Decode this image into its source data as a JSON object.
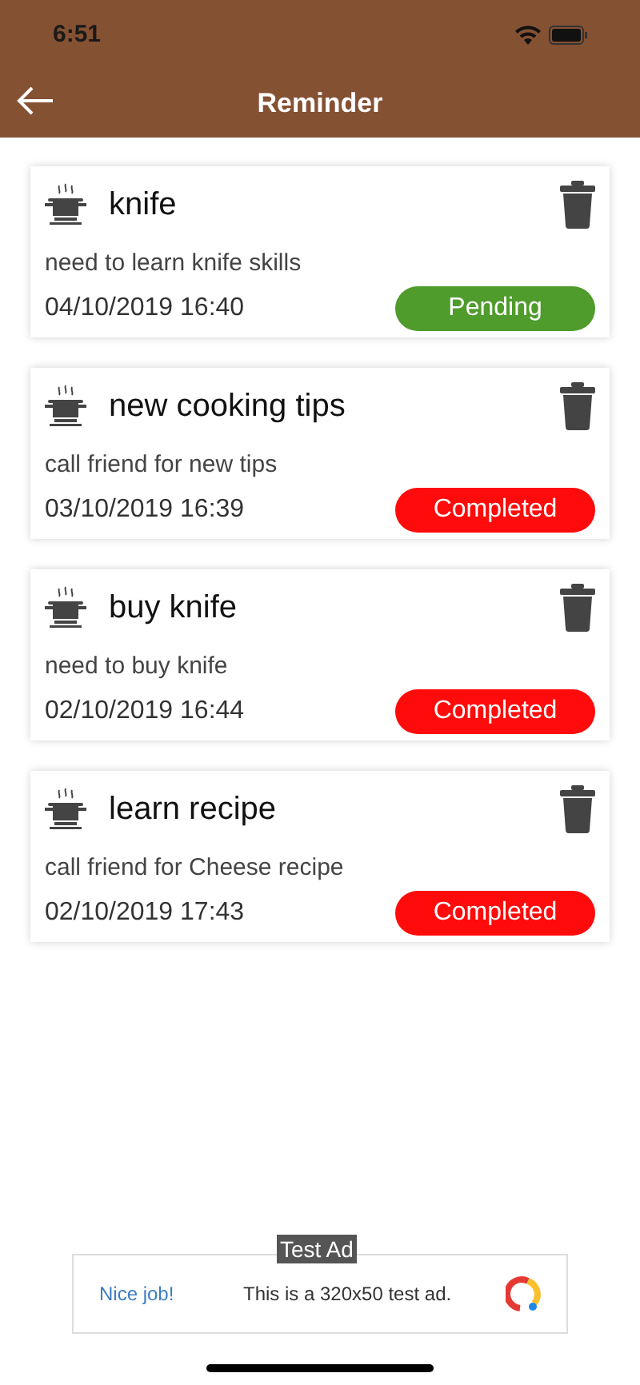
{
  "status_bar": {
    "time": "6:51"
  },
  "header": {
    "title": "Reminder"
  },
  "reminders": [
    {
      "title": "knife",
      "description": "need to learn knife skills",
      "datetime": "04/10/2019 16:40",
      "status": {
        "kind": "pending",
        "label": "Pending"
      }
    },
    {
      "title": "new cooking tips",
      "description": "call friend for new tips",
      "datetime": "03/10/2019 16:39",
      "status": {
        "kind": "completed",
        "label": "Completed"
      }
    },
    {
      "title": "buy knife",
      "description": "need to buy knife",
      "datetime": "02/10/2019 16:44",
      "status": {
        "kind": "completed",
        "label": "Completed"
      }
    },
    {
      "title": "learn recipe",
      "description": "call friend for Cheese recipe",
      "datetime": "02/10/2019 17:43",
      "status": {
        "kind": "completed",
        "label": "Completed"
      }
    }
  ],
  "ad": {
    "tag": "Test Ad",
    "headline": "Nice job!",
    "text": "This is a 320x50 test ad."
  }
}
